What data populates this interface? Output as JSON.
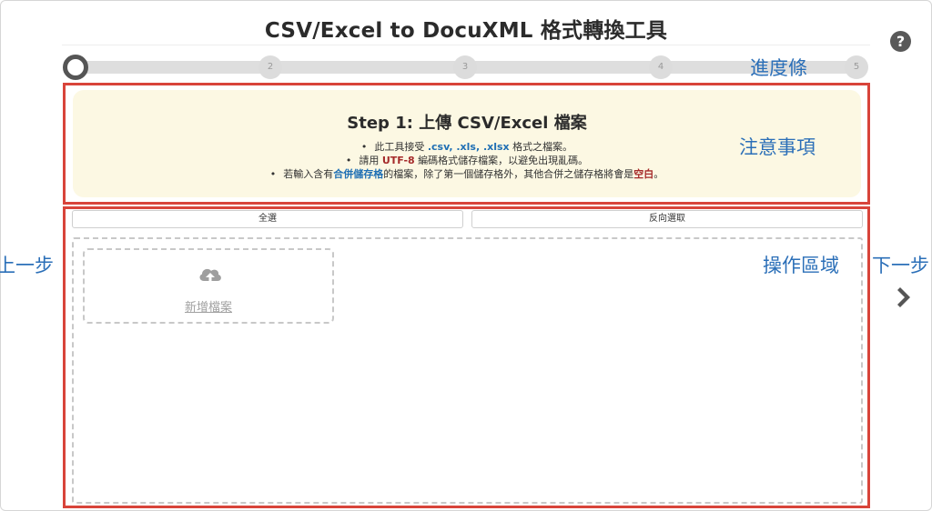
{
  "header": {
    "title": "CSV/Excel to DocuXML 格式轉換工具"
  },
  "help": {
    "icon": "question-circle-icon",
    "glyph": "?"
  },
  "progress": {
    "current_step": 1,
    "steps": [
      "",
      "2",
      "3",
      "4",
      "5"
    ]
  },
  "annotations": {
    "progress_label": "進度條",
    "notice_label": "注意事項",
    "work_area_label": "操作區域",
    "prev_label": "上一步",
    "next_label": "下一步",
    "box_color": "#d8443a",
    "label_color": "#2b6fb8"
  },
  "notice": {
    "title": "Step 1: 上傳 CSV/Excel 檔案",
    "line1": {
      "pre": "此工具接受 ",
      "formats": ".csv, .xls, .xlsx",
      "post": " 格式之檔案。"
    },
    "line2": {
      "pre": "請用 ",
      "encoding": "UTF-8",
      "post": " 編碼格式儲存檔案，以避免出現亂碼。"
    },
    "line3": {
      "pre": "若輸入含有",
      "merged": "合併儲存格",
      "mid": "的檔案，除了第一個儲存格外，其他合併之儲存格將會是",
      "blank": "空白",
      "post": "。"
    }
  },
  "toolbar": {
    "select_all": "全選",
    "invert_selection": "反向選取"
  },
  "upload": {
    "add_file": "新增檔案",
    "icon": "cloud-upload-icon"
  },
  "nav": {
    "next_icon": "chevron-right-icon"
  }
}
